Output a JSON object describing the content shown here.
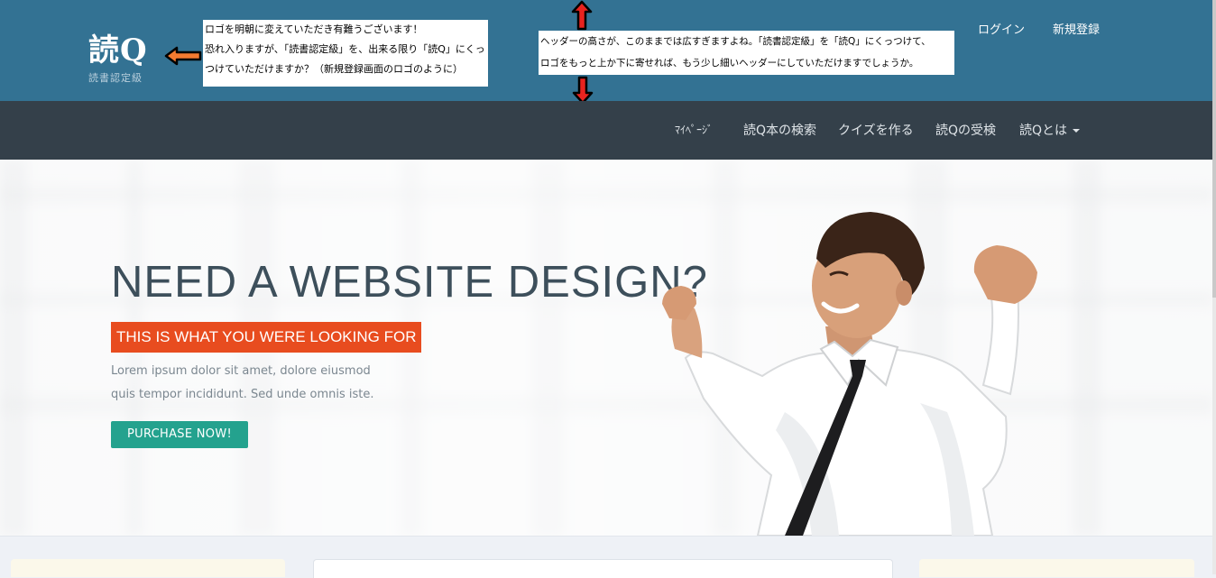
{
  "header": {
    "logo_main": "読Q",
    "logo_sub": "読書認定級",
    "login": "ログイン",
    "register": "新規登録"
  },
  "notes": {
    "logo_note": [
      "ロゴを明朝に変えていただき有難うございます！",
      "恐れ入りますが、「読書認定級」を、出来る限り「読Q」にくっ",
      "つけていただけますか？（新規登録画面のロゴのように）"
    ],
    "header_note": [
      "ヘッダーの高さが、このままでは広すぎますよね。「読書認定級」を「読Q」にくっつけて、",
      "ロゴをもっと上か下に寄せれば、もう少し細いヘッダーにしていただけますでしょうか。"
    ]
  },
  "nav": {
    "items": [
      "ﾏｲﾍﾟｰｼﾞ",
      "読Q本の検索",
      "クイズを作る",
      "読Qの受検",
      "読Qとは"
    ]
  },
  "hero": {
    "title": "NEED A WEBSITE DESIGN?",
    "tagline": "THIS IS WHAT YOU WERE LOOKING FOR",
    "text_line1": "Lorem ipsum dolor sit amet, dolore eiusmod",
    "text_line2": "quis tempor incididunt. Sed unde omnis iste.",
    "button": "PURCHASE NOW!"
  },
  "colors": {
    "header_bg": "#337293",
    "nav_bg": "#34404a",
    "tag_bg": "#e84c1f",
    "button_bg": "#24a28e",
    "arrow_orange": "#f47b30",
    "arrow_red": "#e8231f"
  }
}
